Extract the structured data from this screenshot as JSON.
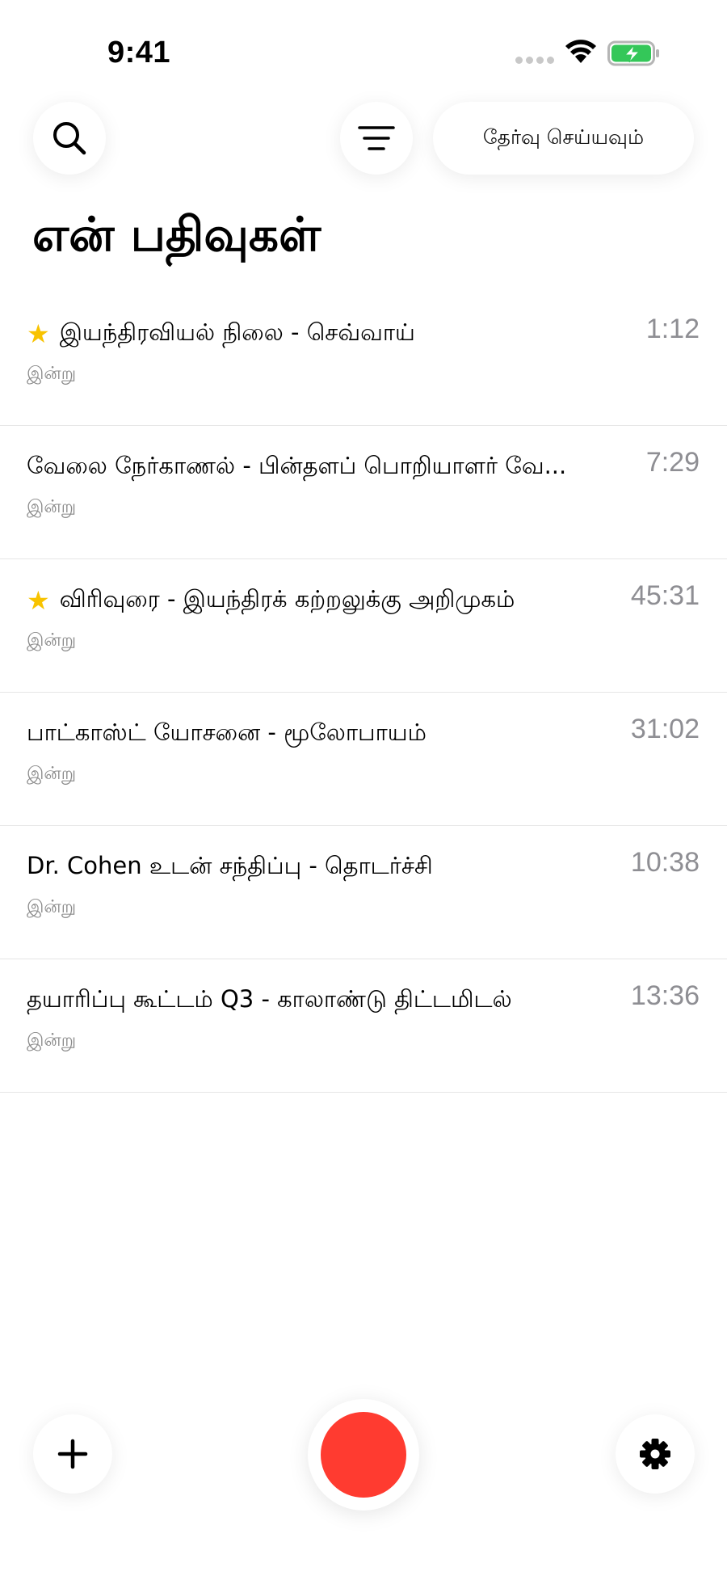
{
  "status_bar": {
    "time": "9:41"
  },
  "header": {
    "select_label": "தேர்வு செய்யவும்",
    "title": "என் பதிவுகள்"
  },
  "recordings": [
    {
      "title": "இயந்திரவியல் நிலை - செவ்வாய்",
      "date": "இன்று",
      "duration": "1:12",
      "starred": true
    },
    {
      "title": "வேலை நேர்காணல் - பின்தளப் பொறியாளர் வே...",
      "date": "இன்று",
      "duration": "7:29",
      "starred": false
    },
    {
      "title": "விரிவுரை - இயந்திரக் கற்றலுக்கு அறிமுகம்",
      "date": "இன்று",
      "duration": "45:31",
      "starred": true
    },
    {
      "title": "பாட்காஸ்ட் யோசனை - மூலோபாயம்",
      "date": "இன்று",
      "duration": "31:02",
      "starred": false
    },
    {
      "title": "Dr. Cohen உடன் சந்திப்பு - தொடர்ச்சி",
      "date": "இன்று",
      "duration": "10:38",
      "starred": false
    },
    {
      "title": "தயாரிப்பு கூட்டம் Q3 - காலாண்டு திட்டமிடல்",
      "date": "இன்று",
      "duration": "13:36",
      "starred": false
    }
  ],
  "icons": {
    "search": "search-icon",
    "filter": "filter-icon",
    "add": "plus-icon",
    "record": "record-icon",
    "settings": "gear-icon",
    "star": "star-icon"
  },
  "colors": {
    "record": "#ff3b30",
    "star": "#f8c300",
    "battery": "#34c759",
    "secondary_text": "#8e8e93"
  }
}
